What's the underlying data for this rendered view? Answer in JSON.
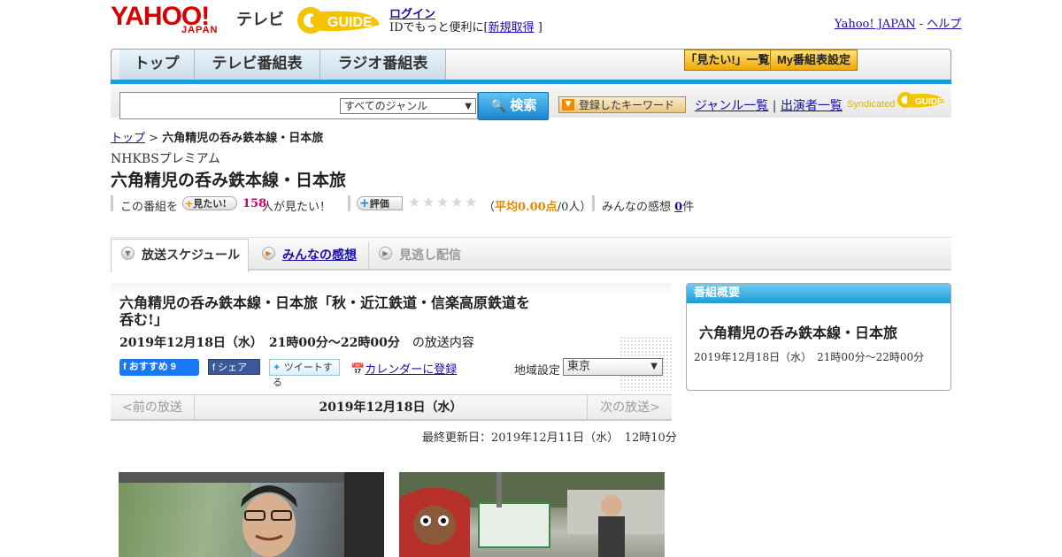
{
  "header": {
    "logo_text": "YAHOO!",
    "logo_sub": "JAPAN",
    "logo_tv": "テレビ",
    "gguide_logo": "GUIDE",
    "login": "ログイン",
    "id_text_prefix": "IDでもっと便利に[",
    "id_register": "新規取得",
    "id_text_suffix": "]",
    "yahoo_japan_link": "Yahoo! JAPAN",
    "sep": " - ",
    "help_link": "ヘルプ"
  },
  "nav": {
    "tabs": [
      "トップ",
      "テレビ番組表",
      "ラジオ番組表"
    ],
    "want_list": "「見たい!」一覧",
    "my_schedule": "My番組表設定"
  },
  "search": {
    "genre_selected": "すべてのジャンル",
    "button": "検索",
    "registered_keyword": "登録したキーワード",
    "genre_list": "ジャンル一覧",
    "performer_list": "出演者一覧",
    "syndicated": "Syndicated"
  },
  "breadcrumb": {
    "top": "トップ",
    "sep": " > ",
    "current": "六角精児の呑み鉄本線・日本旅"
  },
  "program": {
    "channel": "NHKBSプレミアム",
    "title": "六角精児の呑み鉄本線・日本旅",
    "this_program": "この番組を",
    "want_button": "見たい!",
    "want_count": "158",
    "want_suffix": "人が見たい！",
    "rate_button": "評価",
    "avg_prefix": "（",
    "avg_label": "平均0.00点",
    "avg_people": "/0人）",
    "impressions_label": "みんなの感想",
    "impressions_count": "0",
    "impressions_suffix": "件"
  },
  "tabs": {
    "schedule": "放送スケジュール",
    "impressions": "みんなの感想",
    "missed": "見逃し配信"
  },
  "episode": {
    "title": "六角精児の呑み鉄本線・日本旅「秋・近江鉄道・信楽高原鉄道を呑む!」",
    "datetime": "2019年12月18日（水）　21時00分～22時00分",
    "datetime_suffix": "の放送内容",
    "fb_recommend": "おすすめ 9",
    "fb_share": "シェア",
    "tweet": "ツイートする",
    "calendar": "カレンダーに登録",
    "region_label": "地域設定",
    "region_selected": "東京",
    "prev": "<前の放送",
    "next": "次の放送>",
    "pager_date": "2019年12月18日（水）",
    "updated": "最終更新日：2019年12月11日（水）　12時10分"
  },
  "sidebar": {
    "heading": "番組概要",
    "title": "六角精児の呑み鉄本線・日本旅",
    "datetime": "2019年12月18日（水）　21時00分～22時00分"
  },
  "colors": {
    "accent_blue": "#1b9be0",
    "logo_red": "#d60000",
    "want_pink": "#cc0066",
    "rating_orange": "#e08a00"
  }
}
